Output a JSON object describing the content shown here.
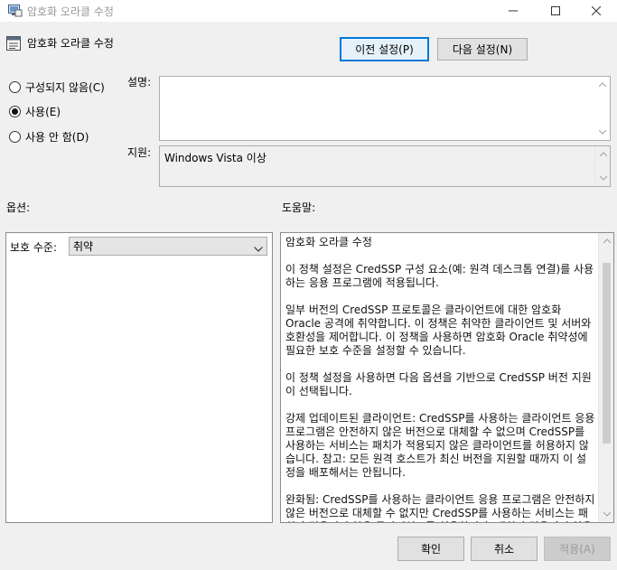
{
  "window": {
    "title": "암호화 오라클 수정"
  },
  "header": {
    "policy_name": "암호화 오라클 수정",
    "prev_button": "이전 설정(P)",
    "next_button": "다음 설정(N)"
  },
  "state": {
    "options": [
      {
        "label": "구성되지 않음(C)",
        "checked": false
      },
      {
        "label": "사용(E)",
        "checked": true
      },
      {
        "label": "사용 안 함(D)",
        "checked": false
      }
    ]
  },
  "fields": {
    "comment_label": "설명:",
    "comment_value": "",
    "supported_label": "지원:",
    "supported_value": "Windows Vista 이상"
  },
  "sections": {
    "options_label": "옵션:",
    "help_label": "도움말:"
  },
  "options_panel": {
    "protection_label": "보호 수준:",
    "protection_value": "취약"
  },
  "help": {
    "paragraphs": [
      "암호화 오라클 수정",
      "이 정책 설정은 CredSSP 구성 요소(예: 원격 데스크톱 연결)를 사용하는 응용 프로그램에 적용됩니다.",
      "일부 버전의 CredSSP 프로토콜은 클라이언트에 대한 암호화 Oracle 공격에 취약합니다.  이 정책은 취약한 클라이언트 및 서버와 호환성을 제어합니다.  이 정책을 사용하면 암호화 Oracle 취약성에 필요한 보호 수준을 설정할 수 있습니다.",
      "이 정책 설정을 사용하면 다음 옵션을 기반으로 CredSSP 버전 지원이 선택됩니다.",
      "강제 업데이트된 클라이언트: CredSSP를 사용하는 클라이언트 응용 프로그램은 안전하지 않은 버전으로 대체할 수 없으며 CredSSP를 사용하는 서비스는 패치가 적용되지 않은 클라이언트를 허용하지 않습니다. 참고: 모든 원격 호스트가 최신 버전을 지원할 때까지 이 설정을 배포해서는 안됩니다.",
      "완화됨: CredSSP를 사용하는 클라이언트 응용 프로그램은 안전하지 않은 버전으로 대체할 수 없지만 CredSSP를 사용하는 서비스는 패치가 적용되지 않은 클라이언트를 허용합니다. 패치가 적용되지 않은 나머지 클라이언트가 어떤 위험에 처할 수 있는지에 대한 중요 정보는 아래 링크를 참조하세요."
    ]
  },
  "footer": {
    "ok": "확인",
    "cancel": "취소",
    "apply": "적용(A)"
  }
}
